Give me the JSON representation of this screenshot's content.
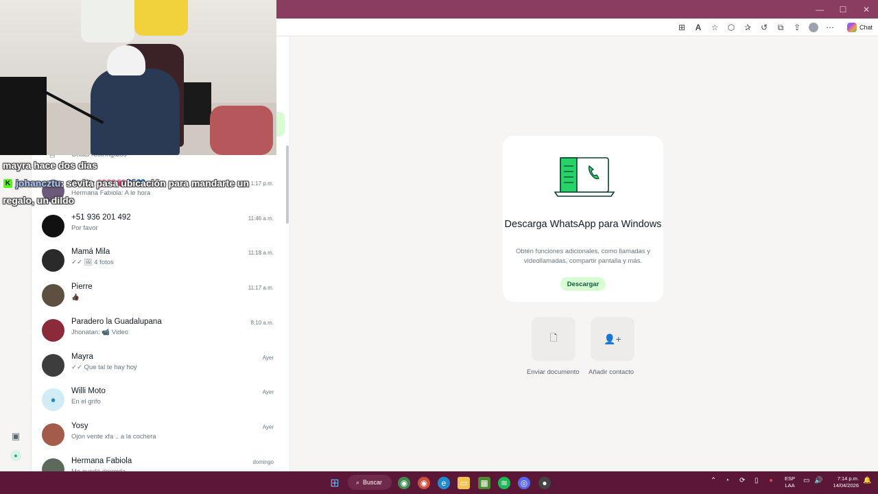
{
  "browser": {
    "window_controls": [
      "—",
      "☐",
      "✕"
    ],
    "toolbar_icons": [
      "apps-icon",
      "read-aloud-icon",
      "favorite-star-icon",
      "extensions-icon",
      "favorites-icon",
      "history-icon",
      "screenshot-icon",
      "share-icon",
      "profile-icon",
      "more-icon"
    ],
    "read_aloud_glyph": "A",
    "chat_label": "Chat"
  },
  "sidebar": {
    "restricted_label": "Chats restringidos"
  },
  "chats": [
    {
      "name": "Family 💗💗💗💙💙",
      "preview": "Hermana Fabiola: A le hora",
      "time": "1:17 p.m.",
      "avatar_color": "#6b5a7a"
    },
    {
      "name": "+51 936 201 492",
      "preview": "Por favor",
      "time": "11:46 a.m.",
      "avatar_color": "#111111"
    },
    {
      "name": "Mamá Mila",
      "preview": "✓✓ 🖼 4 fotos",
      "time": "11:18 a.m.",
      "avatar_color": "#2a2a2a"
    },
    {
      "name": "Pierre",
      "preview": "👍🏿",
      "time": "11:17 a.m.",
      "avatar_color": "#5d5040"
    },
    {
      "name": "Paradero la Guadalupana",
      "preview": "Jhonatan: 📹 Video",
      "time": "8:10 a.m.",
      "avatar_color": "#8a2a3a"
    },
    {
      "name": "Mayra",
      "preview": "✓✓ Que tal te hay hoy",
      "time": "Ayer",
      "avatar_color": "#3d3d3d"
    },
    {
      "name": "Willi Moto",
      "preview": "En el grifo",
      "time": "Ayer",
      "avatar_color": "#d2ecf5"
    },
    {
      "name": "Yosy",
      "preview": "Ojon vente xfa .. a la cochera",
      "time": "Ayer",
      "avatar_color": "#a45c4a"
    },
    {
      "name": "Hermana Fabiola",
      "preview": "Me quedé dormida",
      "time": "domingo",
      "avatar_color": "#5b6a5a"
    }
  ],
  "promo": {
    "title": "Descarga WhatsApp para Windows",
    "description": "Obtén funciones adicionales, como llamadas y videollamadas, compartir pantalla y más.",
    "button": "Descargar"
  },
  "actions": [
    {
      "label": "Enviar documento",
      "icon": "document-icon"
    },
    {
      "label": "Añadir contacto",
      "icon": "add-contact-icon"
    }
  ],
  "stream_overlay": {
    "line1": "mayra hace dos dias",
    "username": "johancztu",
    "message_part1": ": sevita pasa ubicación para mandarte un",
    "message_part2": "regalo, un dildo",
    "badge": "K"
  },
  "taskbar": {
    "search_label": "Buscar",
    "language": "ESP",
    "layout": "LAA",
    "time": "7:14 p.m.",
    "date": "14/04/2026"
  },
  "colors": {
    "titlebar": "#8a3d5e",
    "taskbar": "#5a1836",
    "whatsapp_green": "#25d366",
    "download_bg": "#d9fdd3"
  }
}
